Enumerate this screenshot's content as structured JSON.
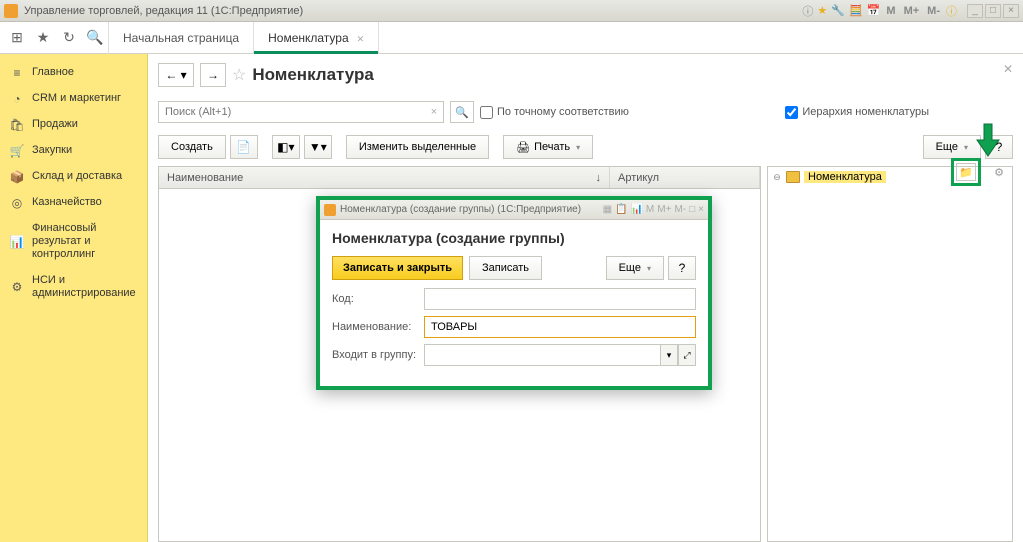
{
  "titlebar": {
    "title": "Управление торговлей, редакция 11  (1С:Предприятие)"
  },
  "tabs": {
    "home": "Начальная страница",
    "active": "Номенклатура"
  },
  "sidebar": [
    {
      "icon": "≡",
      "label": "Главное"
    },
    {
      "icon": "◔",
      "label": "CRM и маркетинг"
    },
    {
      "icon": "🛍",
      "label": "Продажи"
    },
    {
      "icon": "🛒",
      "label": "Закупки"
    },
    {
      "icon": "📦",
      "label": "Склад и доставка"
    },
    {
      "icon": "◎",
      "label": "Казначейство"
    },
    {
      "icon": "📊",
      "label": "Финансовый результат и контроллинг"
    },
    {
      "icon": "⚙",
      "label": "НСИ и администрирование"
    }
  ],
  "page": {
    "title": "Номенклатура"
  },
  "search": {
    "placeholder": "Поиск (Alt+1)",
    "exact_match": "По точному соответствию",
    "hierarchy": "Иерархия номенклатуры"
  },
  "toolbar": {
    "create": "Создать",
    "change_selected": "Изменить выделенные",
    "print": "Печать",
    "more": "Еще"
  },
  "table": {
    "name_col": "Наименование",
    "sort": "↓",
    "article_col": "Артикул"
  },
  "tree": {
    "root": "Номенклатура"
  },
  "dialog": {
    "title": "Номенклатура (создание группы)  (1С:Предприятие)",
    "header": "Номенклатура (создание группы)",
    "save_close": "Записать и закрыть",
    "save": "Записать",
    "more": "Еще",
    "code_label": "Код:",
    "code_value": "",
    "name_label": "Наименование:",
    "name_value": "ТОВАРЫ",
    "group_label": "Входит в группу:",
    "group_value": ""
  }
}
